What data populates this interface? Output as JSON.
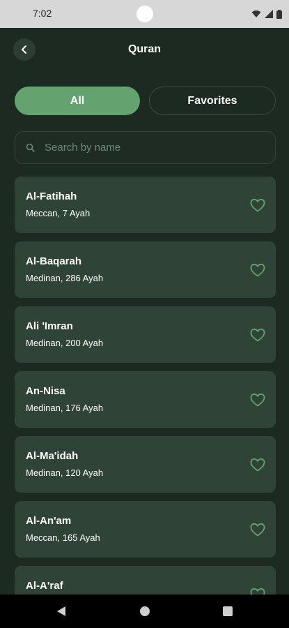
{
  "status_bar": {
    "time": "7:02"
  },
  "header": {
    "title": "Quran",
    "back_icon": "chevron-left-icon"
  },
  "tabs": [
    {
      "label": "All",
      "active": true
    },
    {
      "label": "Favorites",
      "active": false
    }
  ],
  "search": {
    "placeholder": "Search by name",
    "value": ""
  },
  "surahs": [
    {
      "name": "Al-Fatihah",
      "meta": "Meccan, 7 Ayah"
    },
    {
      "name": "Al-Baqarah",
      "meta": "Medinan, 286 Ayah"
    },
    {
      "name": "Ali 'Imran",
      "meta": "Medinan, 200 Ayah"
    },
    {
      "name": "An-Nisa",
      "meta": "Medinan, 176 Ayah"
    },
    {
      "name": "Al-Ma'idah",
      "meta": "Medinan, 120 Ayah"
    },
    {
      "name": "Al-An'am",
      "meta": "Meccan, 165 Ayah"
    },
    {
      "name": "Al-A'raf",
      "meta": ""
    }
  ],
  "colors": {
    "background": "#1d2a22",
    "card": "#2f4436",
    "accent": "#64a36f",
    "heart": "#64a36f"
  },
  "nav": {
    "back": "back-triangle-icon",
    "home": "home-circle-icon",
    "recents": "recents-square-icon"
  }
}
